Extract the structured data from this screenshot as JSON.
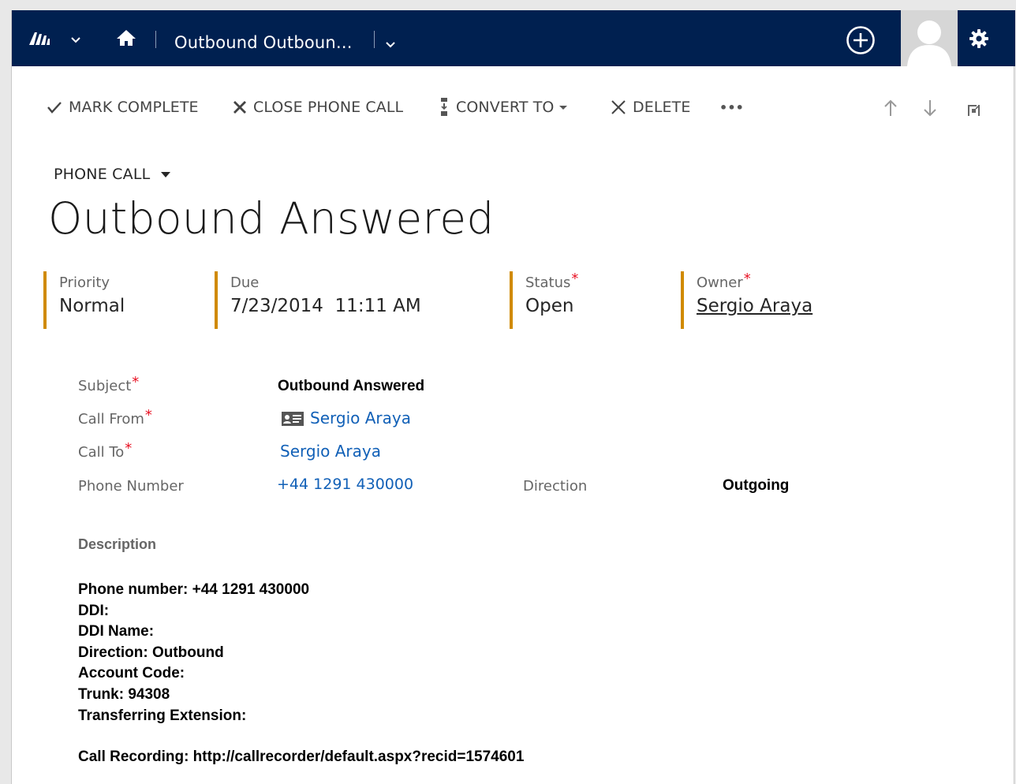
{
  "navbar": {
    "title": "Outbound Outboun...",
    "colors": {
      "background": "#002050",
      "avatar_bg": "#d6d6d6"
    },
    "icons": [
      "dynamics-logo-icon",
      "chevron-down-icon",
      "home-icon",
      "chevron-down-icon",
      "add-circle-icon",
      "user-avatar-icon",
      "gear-icon"
    ]
  },
  "commands": {
    "mark_complete": "MARK COMPLETE",
    "close_phone_call": "CLOSE PHONE CALL",
    "convert_to": "CONVERT TO",
    "delete": "DELETE",
    "more": "•••"
  },
  "header": {
    "entity": "PHONE CALL",
    "title": "Outbound Answered",
    "accent": "#d08a00",
    "fields": {
      "priority": {
        "label": "Priority",
        "value": "Normal"
      },
      "due": {
        "label": "Due",
        "value": "7/23/2014  11:11 AM"
      },
      "status": {
        "label": "Status",
        "value": "Open",
        "required": "*"
      },
      "owner": {
        "label": "Owner",
        "value": "Sergio Araya",
        "required": "*"
      }
    }
  },
  "form": {
    "subject": {
      "label": "Subject",
      "value": "Outbound Answered",
      "required": "*"
    },
    "call_from": {
      "label": "Call From",
      "value": "Sergio Araya",
      "required": "*"
    },
    "call_to": {
      "label": "Call To",
      "value": "Sergio Araya",
      "required": "*"
    },
    "phone_number": {
      "label": "Phone Number",
      "value": "+44 1291 430000"
    },
    "direction": {
      "label": "Direction",
      "value": "Outgoing"
    },
    "link_color": "#1160b7"
  },
  "description": {
    "label": "Description",
    "lines": [
      "Phone number: +44 1291 430000",
      "DDI:",
      "DDI Name:",
      "Direction: Outbound",
      "Account Code:",
      "Trunk: 94308",
      "Transferring Extension:"
    ],
    "recording": "Call Recording: http://callrecorder/default.aspx?recid=1574601"
  }
}
